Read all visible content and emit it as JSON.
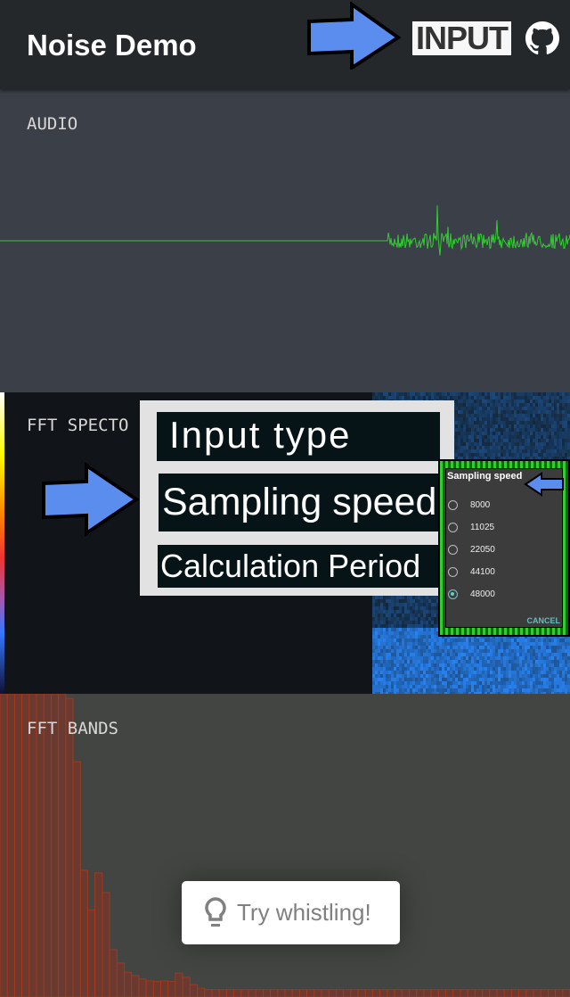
{
  "app": {
    "title": "Noise Demo",
    "input_label": "INPUT",
    "github_icon": "github-icon"
  },
  "panels": {
    "audio": "AUDIO",
    "spectrogram": "FFT SPECTO",
    "bands": "FFT BANDS"
  },
  "menu": {
    "items": [
      "Input type",
      "Sampling speed",
      "Calculation Period"
    ]
  },
  "dialog": {
    "title": "Sampling speed",
    "options": [
      "8000",
      "11025",
      "22050",
      "44100",
      "48000"
    ],
    "selected": "48000",
    "cancel": "CANCEL"
  },
  "toast": {
    "icon": "lightbulb-icon",
    "text": "Try whistling!"
  },
  "colors": {
    "appbar": "#24282b",
    "audio_bg": "#3b3f47",
    "waveform": "#2fd02f",
    "bands_bar": "#6a3a30",
    "bands_edge": "#b03818",
    "arrow": "#5b8def"
  },
  "chart_data": {
    "type": "bar",
    "title": "FFT BANDS",
    "values": [
      1,
      1,
      1,
      1,
      1,
      1,
      1,
      1,
      1,
      0.985,
      0.776,
      0.418,
      0.288,
      0.409,
      0.344,
      0.156,
      0.112,
      0.082,
      0.071,
      0.059,
      0.053,
      0.051,
      0.053,
      0.051,
      0.079,
      0.065,
      0.041,
      0.029,
      0.024,
      0.024,
      0.024,
      0.024,
      0.024,
      0.024,
      0.024,
      0.024,
      0.024,
      0.024,
      0.024,
      0.024,
      0.024,
      0.024,
      0.024,
      0.024,
      0.024,
      0.024,
      0.024,
      0.024,
      0.024,
      0.024,
      0.024,
      0.024,
      0.024,
      0.024,
      0.024,
      0.024,
      0.024,
      0.024,
      0.024,
      0.024,
      0.024,
      0.024,
      0.024,
      0.024,
      0.024,
      0.024,
      0.024,
      0.024,
      0.024,
      0.024,
      0.024,
      0.024,
      0.024,
      0.024,
      0.024,
      0.024,
      0.024,
      0.024
    ],
    "ylim": [
      0,
      1
    ]
  }
}
